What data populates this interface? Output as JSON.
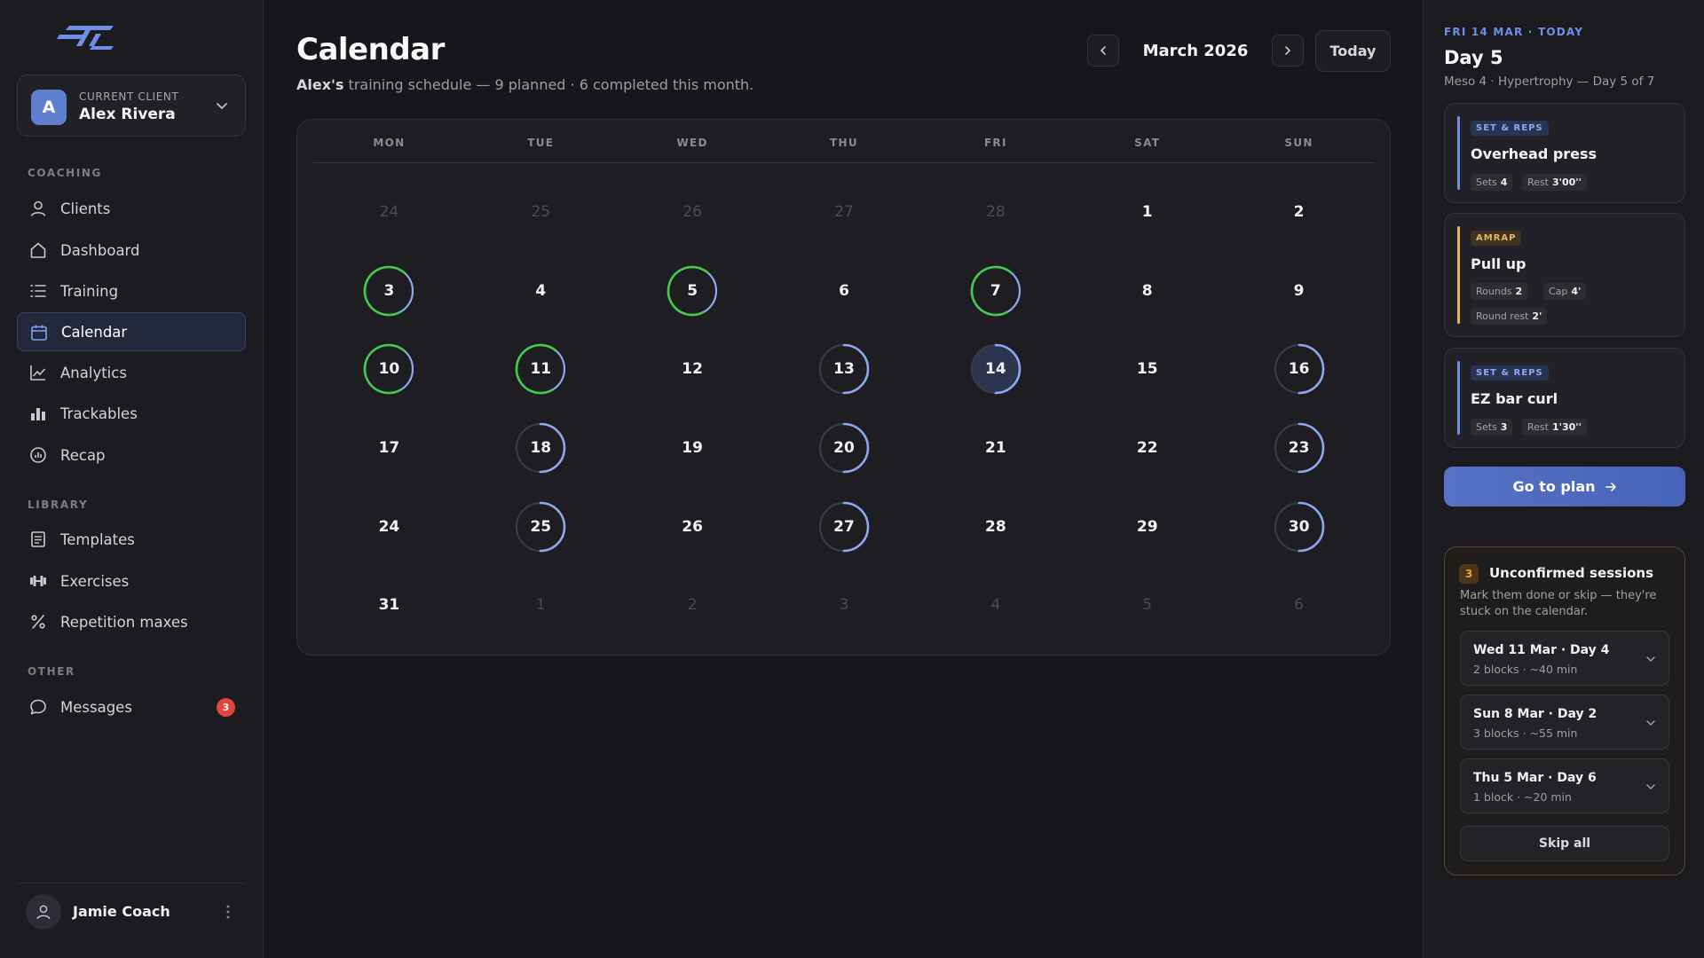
{
  "colors": {
    "accent": "#6f8ee8",
    "completed_ring": "#45c94f",
    "planned_ring": "#8ea8f0",
    "unconfirmed_accent": "#f0a23a",
    "badge_red": "#e0463d"
  },
  "sidebar": {
    "client_card": {
      "caption": "CURRENT CLIENT",
      "name": "Alex Rivera",
      "initial": "A"
    },
    "sections": [
      {
        "label": "COACHING",
        "items": [
          {
            "label": "Clients",
            "icon": "user-icon"
          },
          {
            "label": "Dashboard",
            "icon": "home-icon"
          },
          {
            "label": "Training",
            "icon": "list-icon"
          },
          {
            "label": "Calendar",
            "icon": "calendar-icon",
            "active": true
          },
          {
            "label": "Analytics",
            "icon": "line-chart-icon"
          },
          {
            "label": "Trackables",
            "icon": "bar-chart-icon"
          },
          {
            "label": "Recap",
            "icon": "gauge-icon"
          }
        ]
      },
      {
        "label": "LIBRARY",
        "items": [
          {
            "label": "Templates",
            "icon": "document-icon"
          },
          {
            "label": "Exercises",
            "icon": "dumbbell-icon"
          },
          {
            "label": "Repetition maxes",
            "icon": "percent-icon"
          }
        ]
      },
      {
        "label": "OTHER",
        "items": [
          {
            "label": "Messages",
            "icon": "chat-bubble-icon",
            "badge": "3"
          }
        ]
      }
    ],
    "user": {
      "name": "Jamie Coach"
    }
  },
  "header": {
    "title": "Calendar",
    "subtitle_name": "Alex's",
    "subtitle_rest": " training schedule — 9 planned · 6 completed this month.",
    "month_label": "March 2026",
    "today_label": "Today"
  },
  "calendar": {
    "weekdays": [
      "MON",
      "TUE",
      "WED",
      "THU",
      "FRI",
      "SAT",
      "SUN"
    ],
    "weeks": [
      [
        {
          "d": "24",
          "out": true
        },
        {
          "d": "25",
          "out": true
        },
        {
          "d": "26",
          "out": true
        },
        {
          "d": "27",
          "out": true
        },
        {
          "d": "28",
          "out": true
        },
        {
          "d": "1"
        },
        {
          "d": "2"
        }
      ],
      [
        {
          "d": "3",
          "s": "completed"
        },
        {
          "d": "4"
        },
        {
          "d": "5",
          "s": "completed"
        },
        {
          "d": "6"
        },
        {
          "d": "7",
          "s": "completed"
        },
        {
          "d": "8"
        },
        {
          "d": "9"
        }
      ],
      [
        {
          "d": "10",
          "s": "completed"
        },
        {
          "d": "11",
          "s": "completed"
        },
        {
          "d": "12"
        },
        {
          "d": "13",
          "s": "planned"
        },
        {
          "d": "14",
          "s": "today"
        },
        {
          "d": "15"
        },
        {
          "d": "16",
          "s": "planned"
        }
      ],
      [
        {
          "d": "17"
        },
        {
          "d": "18",
          "s": "planned"
        },
        {
          "d": "19"
        },
        {
          "d": "20",
          "s": "planned"
        },
        {
          "d": "21"
        },
        {
          "d": "22"
        },
        {
          "d": "23",
          "s": "planned"
        }
      ],
      [
        {
          "d": "24"
        },
        {
          "d": "25",
          "s": "planned"
        },
        {
          "d": "26"
        },
        {
          "d": "27",
          "s": "planned"
        },
        {
          "d": "28"
        },
        {
          "d": "29"
        },
        {
          "d": "30",
          "s": "planned"
        }
      ],
      [
        {
          "d": "31"
        },
        {
          "d": "1",
          "out": true
        },
        {
          "d": "2",
          "out": true
        },
        {
          "d": "3",
          "out": true
        },
        {
          "d": "4",
          "out": true
        },
        {
          "d": "5",
          "out": true
        },
        {
          "d": "6",
          "out": true
        }
      ]
    ]
  },
  "panel": {
    "date_label": "FRI 14 MAR · TODAY",
    "day_title": "Day 5",
    "meso_label": "Meso 4 · Hypertrophy — Day 5 of 7",
    "exercises": [
      {
        "tag": "SET & REPS",
        "name": "Overhead press",
        "chips": [
          {
            "k": "Sets",
            "v": "4"
          },
          {
            "k": "Rest",
            "v": "3'00''"
          }
        ]
      },
      {
        "tag": "AMRAP",
        "name": "Pull up",
        "chips": [
          {
            "k": "Rounds",
            "v": "2"
          },
          {
            "k": "Cap",
            "v": "4'"
          },
          {
            "k": "Round rest",
            "v": "2'"
          }
        ]
      },
      {
        "tag": "SET & REPS",
        "name": "EZ bar curl",
        "chips": [
          {
            "k": "Sets",
            "v": "3"
          },
          {
            "k": "Rest",
            "v": "1'30''"
          }
        ]
      }
    ],
    "go_to_plan_label": "Go to plan",
    "unconfirmed": {
      "count": "3",
      "title": "Unconfirmed sessions",
      "description": "Mark them done or skip — they're stuck on the calendar.",
      "sessions": [
        {
          "title": "Wed 11 Mar · Day 4",
          "meta": "2 blocks · ~40 min"
        },
        {
          "title": "Sun 8 Mar · Day 2",
          "meta": "3 blocks · ~55 min"
        },
        {
          "title": "Thu 5 Mar · Day 6",
          "meta": "1 block · ~20 min"
        }
      ],
      "skip_all_label": "Skip all"
    }
  }
}
